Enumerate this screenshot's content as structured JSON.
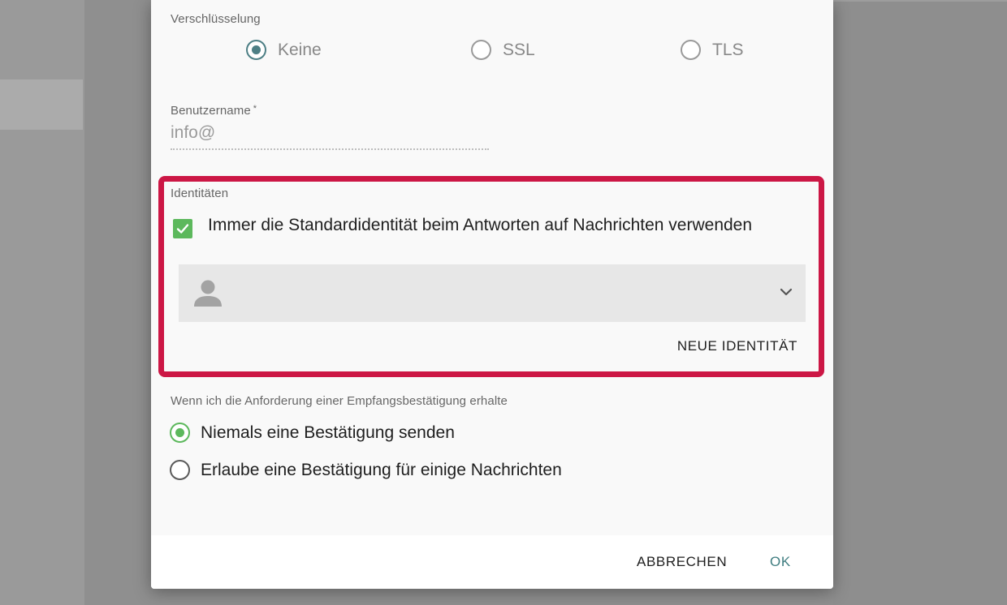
{
  "encryption": {
    "label": "Verschlüsselung",
    "options": [
      "Keine",
      "SSL",
      "TLS"
    ],
    "selected": "Keine"
  },
  "username": {
    "label": "Benutzername",
    "required_marker": "*",
    "value": "info@"
  },
  "identities": {
    "label": "Identitäten",
    "always_default_label": "Immer die Standardidentität beim Antworten auf Nachrichten verwenden",
    "always_default_checked": true,
    "select_icon": "person-icon",
    "new_identity_label": "NEUE IDENTITÄT"
  },
  "receipt": {
    "label": "Wenn ich die Anforderung einer Empfangsbestätigung erhalte",
    "options": [
      "Niemals eine Bestätigung senden",
      "Erlaube eine Bestätigung für einige Nachrichten"
    ],
    "selected": "Niemals eine Bestätigung senden"
  },
  "footer": {
    "cancel_label": "ABBRECHEN",
    "ok_label": "OK"
  },
  "colors": {
    "accent_teal": "#4d7f85",
    "accent_green": "#5cb85c",
    "highlight": "#cc1745"
  }
}
